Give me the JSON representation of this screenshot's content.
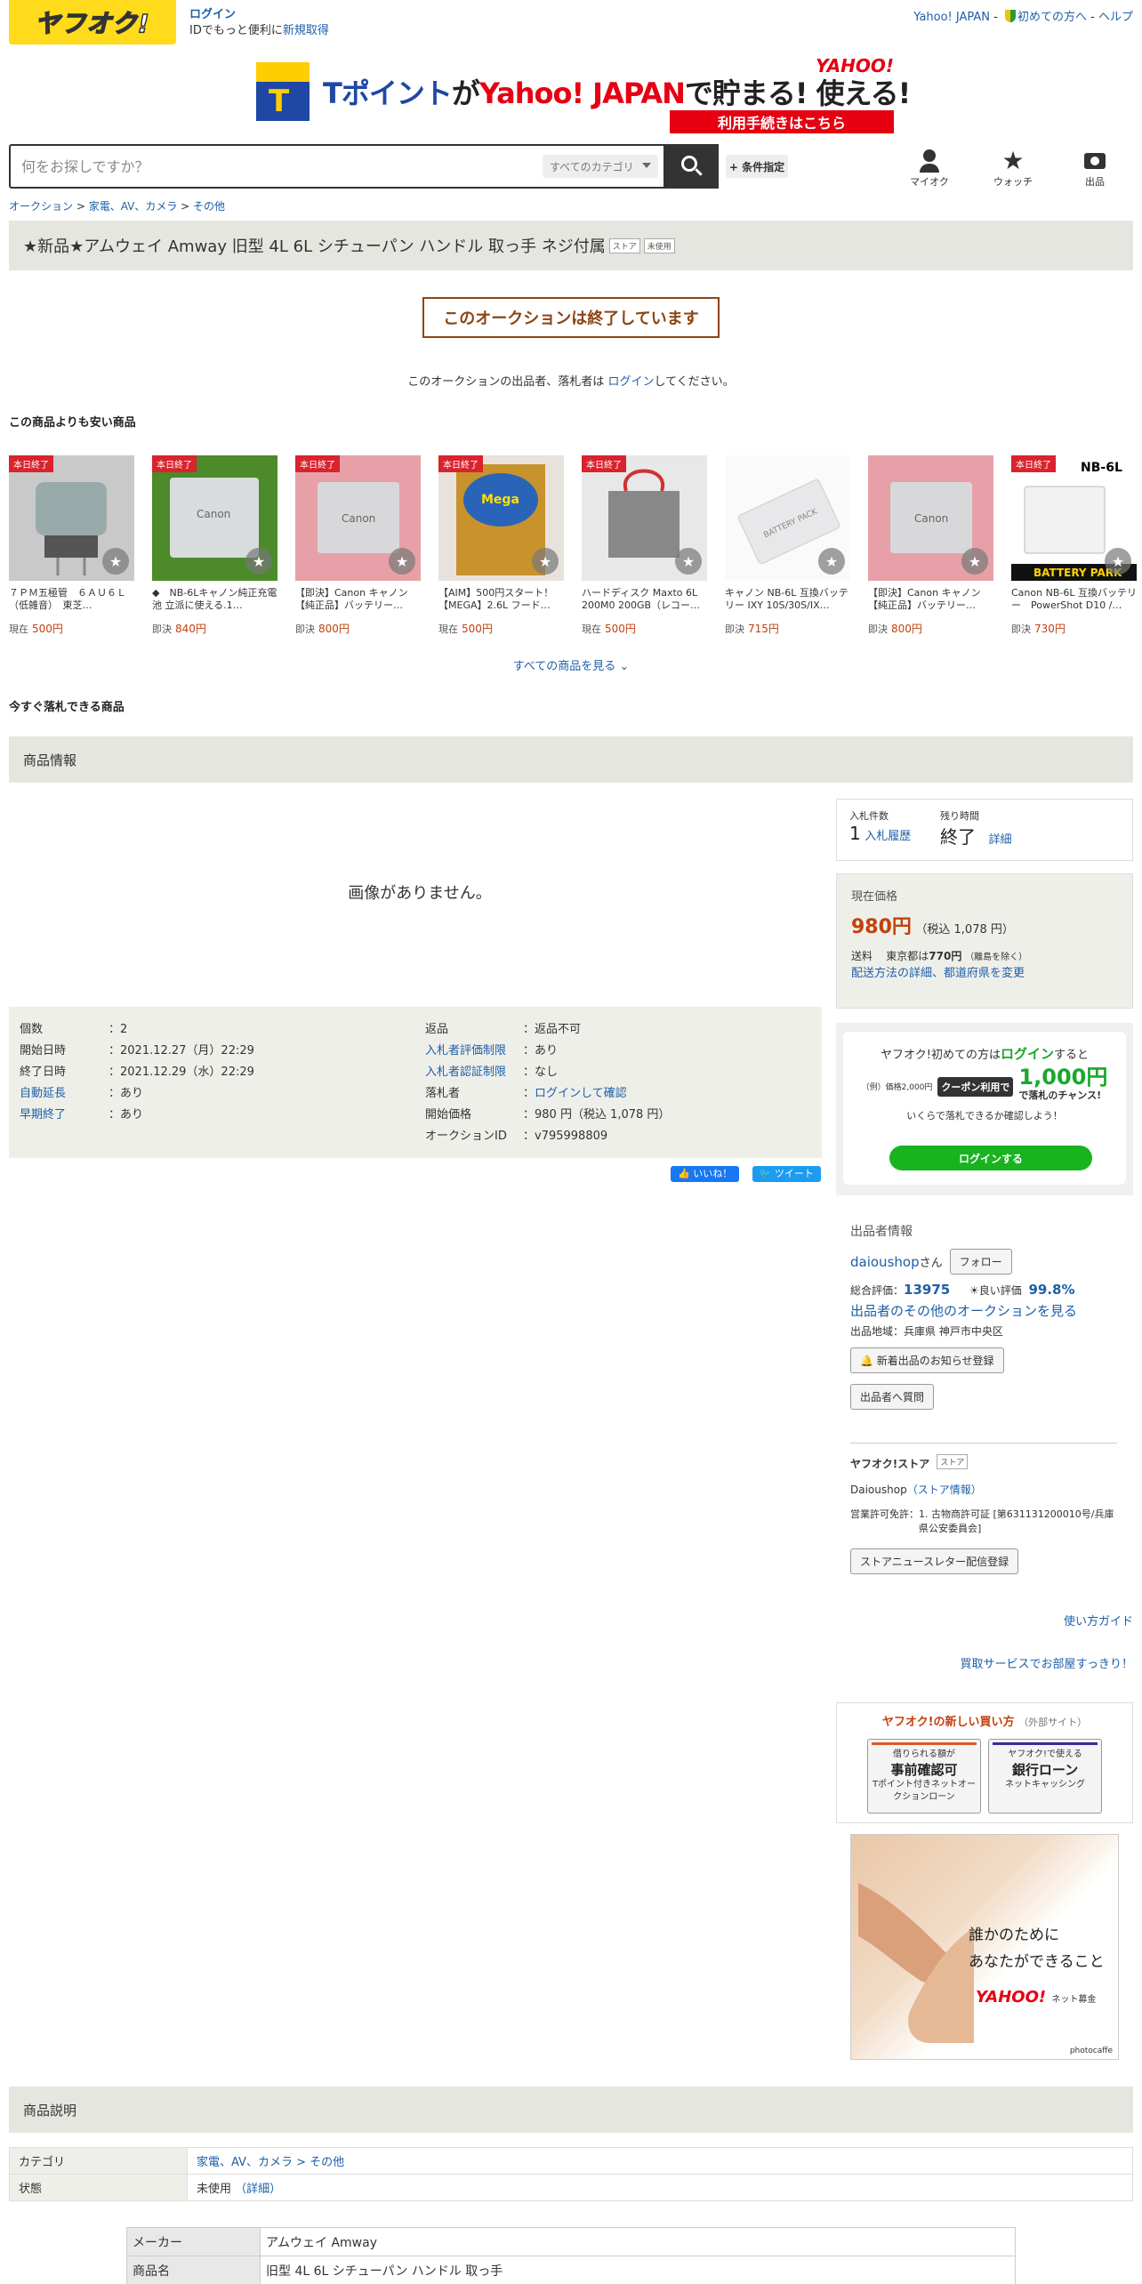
{
  "header": {
    "logo": "ヤフオク!",
    "login": "ログイン",
    "login_sub_prefix": "IDでもっと便利に",
    "register": "新規取得",
    "links": [
      "Yahoo! JAPAN",
      "初めての方へ",
      "ヘルプ"
    ]
  },
  "banner": {
    "prefix": "Tポイント",
    "ga": "が",
    "brand": "Yahoo! JAPAN",
    "suffix": "で貯まる! 使える!",
    "corner": "YAHOO!",
    "button": "利用手続きはこちら"
  },
  "search": {
    "placeholder": "何をお探しですか？",
    "category": "すべてのカテゴリ",
    "conditions": "+ 条件指定"
  },
  "nav": {
    "myauc": "マイオク",
    "watch": "ウォッチ",
    "sell": "出品"
  },
  "breadcrumb": [
    "オークション",
    "家電、AV、カメラ",
    "その他"
  ],
  "item": {
    "title": "★新品★アムウェイ Amway 旧型 4L 6L シチューパン ハンドル 取っ手 ネジ付属",
    "tags": [
      "ストア",
      "未使用"
    ]
  },
  "ended": "このオークションは終了しています",
  "login_note": {
    "before": "このオークションの出品者、落札者は ",
    "link": "ログイン",
    "after": "してください。"
  },
  "cheaper_heading": "この商品よりも安い商品",
  "products": [
    {
      "tag": "本日終了",
      "name": "７ＰＭ五極管　６ＡＵ６Ｌ（低雑音）　東芝…",
      "ptype": "現在",
      "price": "500円"
    },
    {
      "tag": "本日終了",
      "name": "◆　NB-6Lキャノン純正充電池 立派に使える.1…",
      "ptype": "即決",
      "price": "840円"
    },
    {
      "tag": "本日終了",
      "name": "【即決】Canon キャノン【純正品】バッテリー…",
      "ptype": "即決",
      "price": "800円"
    },
    {
      "tag": "本日終了",
      "name": "【AIM】500円スタート！【MEGA】2.6L フード…",
      "ptype": "現在",
      "price": "500円"
    },
    {
      "tag": "本日終了",
      "name": "ハードディスク Maxto 6L 200M0 200GB（レコー…",
      "ptype": "現在",
      "price": "500円"
    },
    {
      "tag": "",
      "name": "キャノン NB-6L 互換バッテリー IXY 10S/30S/IX…",
      "ptype": "即決",
      "price": "715円"
    },
    {
      "tag": "",
      "name": "【即決】Canon キャノン【純正品】バッテリー…",
      "ptype": "即決",
      "price": "800円"
    },
    {
      "tag": "本日終了",
      "name": "Canon NB-6L 互換バッテリー　PowerShot D10 /…",
      "ptype": "即決",
      "price": "730円"
    }
  ],
  "product_images": {
    "p8_label": "NB-6L",
    "p8_band": "BATTERY PARK"
  },
  "see_all": "すべての商品を見る",
  "buynow_heading": "今すぐ落札できる商品",
  "info_heading": "商品情報",
  "no_image": "画像がありません。",
  "details_left": [
    {
      "k": "個数",
      "v": "：2",
      "link": false
    },
    {
      "k": "開始日時",
      "v": "：2021.12.27（月）22:29",
      "link": false
    },
    {
      "k": "終了日時",
      "v": "：2021.12.29（水）22:29",
      "link": false
    },
    {
      "k": "自動延長",
      "v": "：あり",
      "link": true
    },
    {
      "k": "早期終了",
      "v": "：あり",
      "link": true
    }
  ],
  "details_right": [
    {
      "k": "返品",
      "v": "：返品不可",
      "link": false
    },
    {
      "k": "入札者評価制限",
      "v": "：あり",
      "link": true
    },
    {
      "k": "入札者認証制限",
      "v": "：なし",
      "link": true
    },
    {
      "k": "落札者",
      "v": "ログインして確認",
      "link": false,
      "vlink": true
    },
    {
      "k": "開始価格",
      "v": "：980 円（税込 1,078 円）",
      "link": false
    },
    {
      "k": "オークションID",
      "v": "：v795998809",
      "link": false
    }
  ],
  "share": {
    "like": "いいね！",
    "tweet": "ツイート"
  },
  "bid": {
    "count_label": "入札件数",
    "count": "1",
    "history": "入札履歴",
    "time_label": "残り時間",
    "time": "終了",
    "detail": "詳細"
  },
  "price": {
    "label": "現在価格",
    "value": "980円",
    "tax": "（税込 1,078 円）",
    "ship_label": "送料",
    "ship_area": "東京都は",
    "ship_value": "770円",
    "ship_note": "（離島を除く）",
    "ship_link": "配送方法の詳細、都道府県を変更"
  },
  "coupon": {
    "l1a": "ヤフオク!初めての方は",
    "l1b": "ログイン",
    "l1c": "すると",
    "example": "（例）価格2,000円",
    "badge": "クーポン利用で",
    "amount": "1,000円",
    "chance": "で落札のチャンス!",
    "l3": "いくらで落札できるか確認しよう！",
    "button": "ログインする"
  },
  "seller": {
    "heading": "出品者情報",
    "name": "daioushop",
    "san": "さん",
    "follow": "フォロー",
    "total_label": "総合評価：",
    "total": "13975",
    "good_label": "良い評価",
    "good": "99.8%",
    "other": "出品者のその他のオークションを見る",
    "region": "出品地域：兵庫県 神戸市中央区",
    "notify": "新着出品のお知らせ登録",
    "question": "出品者へ質問"
  },
  "store": {
    "heading": "ヤフオク!ストア",
    "tag": "ストア",
    "name": "Daioushop",
    "info": "（ストア情報）",
    "license_label": "営業許可免許：",
    "license": "1. 古物商許可証 [第631131200010号/兵庫県公安委員会]",
    "newsletter": "ストアニュースレター配信登録"
  },
  "guide": "使い方ガイド",
  "buy_service": "買取サービスでお部屋すっきり！",
  "newbuy": {
    "heading": "ヤフオク!の新しい買い方",
    "note": "（外部サイト）",
    "b1_top": "借りられる額が",
    "b1_title": "事前確認可",
    "b1_sub": "Tポイント付きネットオークションローン",
    "b2_top": "ヤフオク!で使える",
    "b2_title": "銀行ローン",
    "b2_sub": "ネットキャッシング"
  },
  "ad": {
    "copy1": "誰かのために",
    "copy2": "あなたができること",
    "brand": "YAHOO!",
    "brand_sub": "ネット募金",
    "credit": "photocaffe"
  },
  "desc_heading": "商品説明",
  "category_rows": [
    {
      "k": "カテゴリ",
      "v": "家電、AV、カメラ > その他",
      "link": true
    },
    {
      "k": "状態",
      "v": "未使用",
      "extra": "（詳細）",
      "link": false
    }
  ],
  "spec_rows": [
    {
      "k": "メーカー",
      "v": "アムウェイ Amway"
    },
    {
      "k": "商品名",
      "v": "旧型 4L 6L シチューパン ハンドル 取っ手"
    }
  ],
  "colors": {
    "accent": "#ffdb1c",
    "link": "#1d5fa8",
    "price": "#c2410c",
    "green": "#19b320"
  }
}
